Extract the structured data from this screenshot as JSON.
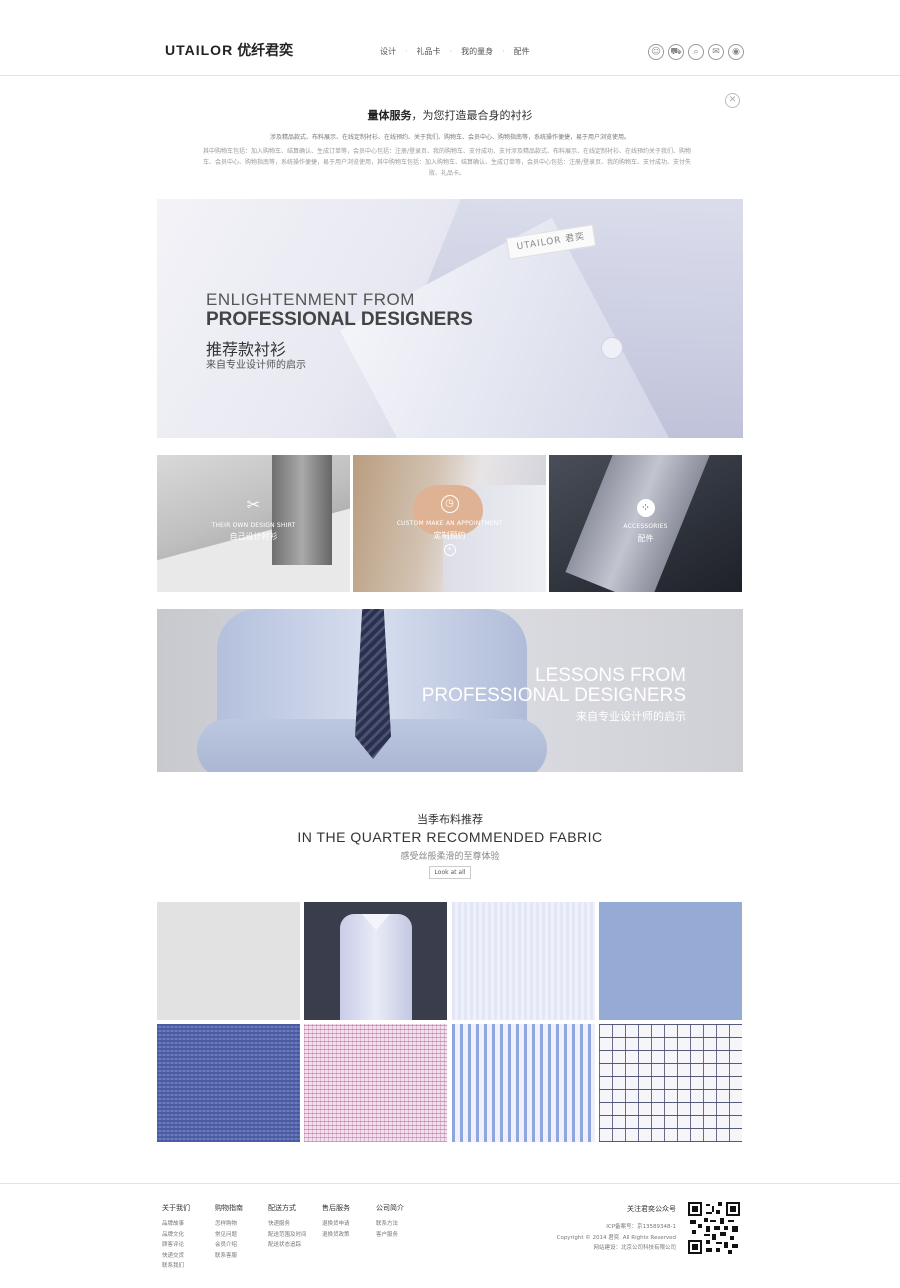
{
  "header": {
    "logo_en": "UTAILOR",
    "logo_cn": "优纤君奕",
    "nav": [
      "设计",
      "礼品卡",
      "我的量身",
      "配件"
    ],
    "icons": [
      "user-icon",
      "cart-icon",
      "search-icon",
      "wechat-icon",
      "weibo-icon"
    ]
  },
  "intro": {
    "title_bold": "量体服务",
    "title_rest": "，为您打造最合身的衬衫",
    "line1": "涉及精品款式、布料展示、在线定制衬衫、在线预约、关于我们、购物车、会员中心、购物指南等，系统操作便捷，易于用户浏览使用。",
    "line2": "其中购物车包括：加入购物车、结算确认、生成订单等，会员中心包括：注册/登录页、我的购物车、支付成功、支付涉及精品款式、布料展示、在线定制衬衫、在线预约关于我们、购物车、会员中心、购物指南等，系统操作便捷，易于用户浏览使用，其中购物车包括：加入购物车、结算确认、生成订单等，会员中心包括：注册/登录页、我的购物车、支付成功、支付失败、礼品卡。"
  },
  "hero": {
    "label_text": "UTAILOR 君奕",
    "line1": "ENLIGHTENMENT FROM",
    "line2": "PROFESSIONAL DESIGNERS",
    "line3": "推荐款衬衫",
    "line4": "来自专业设计师的启示"
  },
  "tiles": [
    {
      "en": "THEIR OWN DESIGN SHIRT",
      "cn": "自己设计衬衫",
      "icon": "scissors-icon"
    },
    {
      "en": "CUSTOM MAKE AN APPOINTMENT",
      "cn": "定制预约",
      "icon": "clock-icon"
    },
    {
      "en": "ACCESSORIES",
      "cn": "配件",
      "icon": "button-icon"
    }
  ],
  "banner": {
    "line1": "LESSONS FROM",
    "line2": "PROFESSIONAL DESIGNERS",
    "line3": "来自专业设计师的启示"
  },
  "fabric": {
    "title_cn": "当季布料推荐",
    "title_en": "IN THE QUARTER RECOMMENDED FABRIC",
    "subtitle": "感受丝般柔滑的至尊体验",
    "button": "Look at all"
  },
  "footer": {
    "columns": [
      {
        "title": "关于我们",
        "items": [
          "品牌故事",
          "品牌文化",
          "顾客评论",
          "快递交货",
          "联系我们"
        ]
      },
      {
        "title": "购物指南",
        "items": [
          "怎样购物",
          "常见问题",
          "会员介绍",
          "联系客服"
        ]
      },
      {
        "title": "配送方式",
        "items": [
          "快递服务",
          "配送范围及时间",
          "配送状态追踪"
        ]
      },
      {
        "title": "售后服务",
        "items": [
          "退换货申请",
          "退换货政策"
        ]
      },
      {
        "title": "公司简介",
        "items": [
          "联系方法",
          "客户服务"
        ]
      }
    ],
    "follow": "关注君奕公众号",
    "icp": "ICP备案号：京13589348-1",
    "copyright": "Copyright © 2014 君奕. All Rights Reserved",
    "builder": "网站建设：北京公司科技有限公司"
  }
}
